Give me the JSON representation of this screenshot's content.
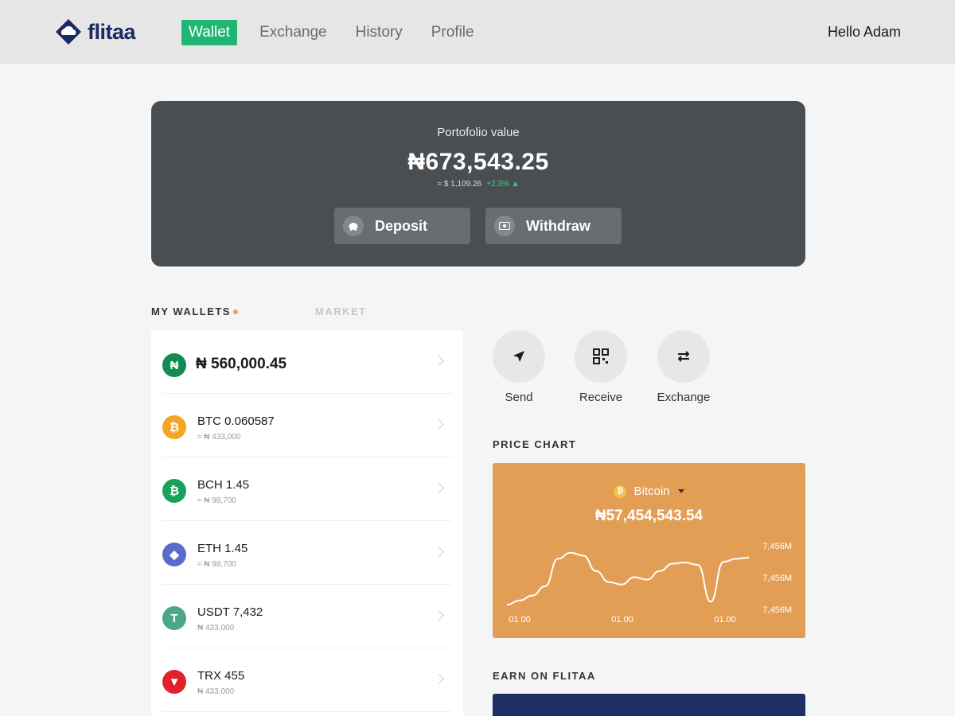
{
  "brand": {
    "name": "flitaa",
    "logo_icon": "cloud-diamond-icon",
    "color": "#1b2a63"
  },
  "nav": {
    "items": [
      {
        "label": "Wallet",
        "active": true
      },
      {
        "label": "Exchange",
        "active": false
      },
      {
        "label": "History",
        "active": false
      },
      {
        "label": "Profile",
        "active": false
      }
    ],
    "accent": "#1fb673"
  },
  "user": {
    "greeting": "Hello Adam"
  },
  "portfolio": {
    "label": "Portofolio value",
    "amount": "₦673,543.25",
    "usd": "≈ $ 1,109.26",
    "change": "+2.3% ▲",
    "deposit_label": "Deposit",
    "withdraw_label": "Withdraw"
  },
  "tabs": {
    "wallets": "MY WALLETS",
    "market": "MARKET"
  },
  "wallets": [
    {
      "title": "₦ 560,000.45",
      "sub": "",
      "icon": "naira-icon",
      "symbol": "₦",
      "color": "#138a4f"
    },
    {
      "title": "BTC 0.060587",
      "sub": "≈ ₦ 433,000",
      "icon": "bitcoin-icon",
      "symbol": "₿",
      "color": "#f3a623"
    },
    {
      "title": "BCH 1.45",
      "sub": "≈ ₦ 98,700",
      "icon": "bitcoin-cash-icon",
      "symbol": "₿",
      "color": "#1aa15b"
    },
    {
      "title": "ETH 1.45",
      "sub": "≈ ₦ 98,700",
      "icon": "ethereum-icon",
      "symbol": "◆",
      "color": "#5b6bc9"
    },
    {
      "title": "USDT 7,432",
      "sub": "₦ 433,000",
      "icon": "tether-icon",
      "symbol": "T",
      "color": "#4aa889"
    },
    {
      "title": "TRX 455",
      "sub": "₦ 433,000",
      "icon": "tron-icon",
      "symbol": "▼",
      "color": "#e0202a"
    }
  ],
  "actions": {
    "send": "Send",
    "receive": "Receive",
    "exchange": "Exchange"
  },
  "price_chart": {
    "section_title": "PRICE CHART",
    "coin": "Bitcoin",
    "price": "₦57,454,543.54",
    "card_color": "#e39e56"
  },
  "earn": {
    "section_title": "EARN ON FLITAA",
    "card_color": "#1d2e65"
  },
  "chart_data": {
    "type": "line",
    "title": "",
    "x_tick_labels": [
      "01.00",
      "01.00",
      "01.00"
    ],
    "y_tick_labels": [
      "7,456M",
      "7,456M",
      "7,456M"
    ],
    "series": [
      {
        "values": [
          0.05,
          0.12,
          0.2,
          0.35,
          0.8,
          0.9,
          0.85,
          0.6,
          0.42,
          0.38,
          0.5,
          0.46,
          0.6,
          0.72,
          0.74,
          0.7,
          0.1,
          0.75,
          0.8,
          0.82
        ]
      }
    ],
    "grid": false
  }
}
